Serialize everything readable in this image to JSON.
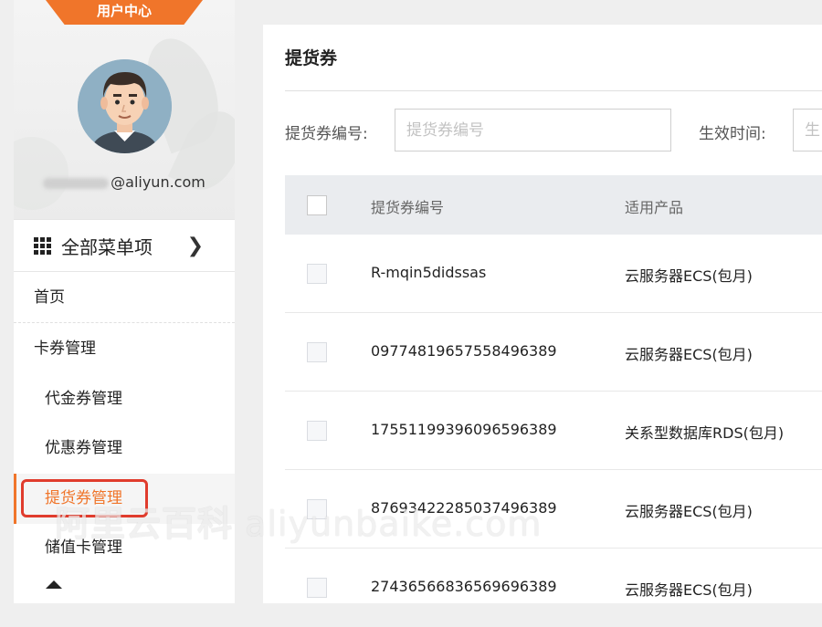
{
  "sidebar": {
    "header_tab": "用户中心",
    "email_suffix": "@aliyun.com",
    "all_menu_label": "全部菜单项",
    "items": [
      {
        "label": "首页"
      },
      {
        "label": "卡券管理"
      },
      {
        "label": "代金券管理"
      },
      {
        "label": "优惠券管理"
      },
      {
        "label": "提货券管理"
      },
      {
        "label": "储值卡管理"
      }
    ]
  },
  "main": {
    "title": "提货券",
    "filters": {
      "code_label": "提货券编号:",
      "code_placeholder": "提货券编号",
      "date_label": "生效时间:",
      "date_placeholder": "生"
    },
    "table": {
      "columns": [
        "提货券编号",
        "适用产品"
      ],
      "rows": [
        {
          "code": "R-mqin5didssas",
          "product": "云服务器ECS(包月)"
        },
        {
          "code": "0977481965755849638​9",
          "product": "云服务器ECS(包月)"
        },
        {
          "code": "1755119939609659638​9",
          "product": "关系型数据库RDS(包月)"
        },
        {
          "code": "8769342228503749638​9",
          "product": "云服务器ECS(包月)"
        },
        {
          "code": "2743656683656969638​9",
          "product": "云服务器ECS(包月)"
        }
      ]
    }
  },
  "watermark": {
    "cn": "阿里云百科",
    "en": "aliyunbaike.com"
  },
  "colors": {
    "accent": "#f0752a",
    "highlight": "#e03c2d",
    "table_header": "#eaecef"
  }
}
